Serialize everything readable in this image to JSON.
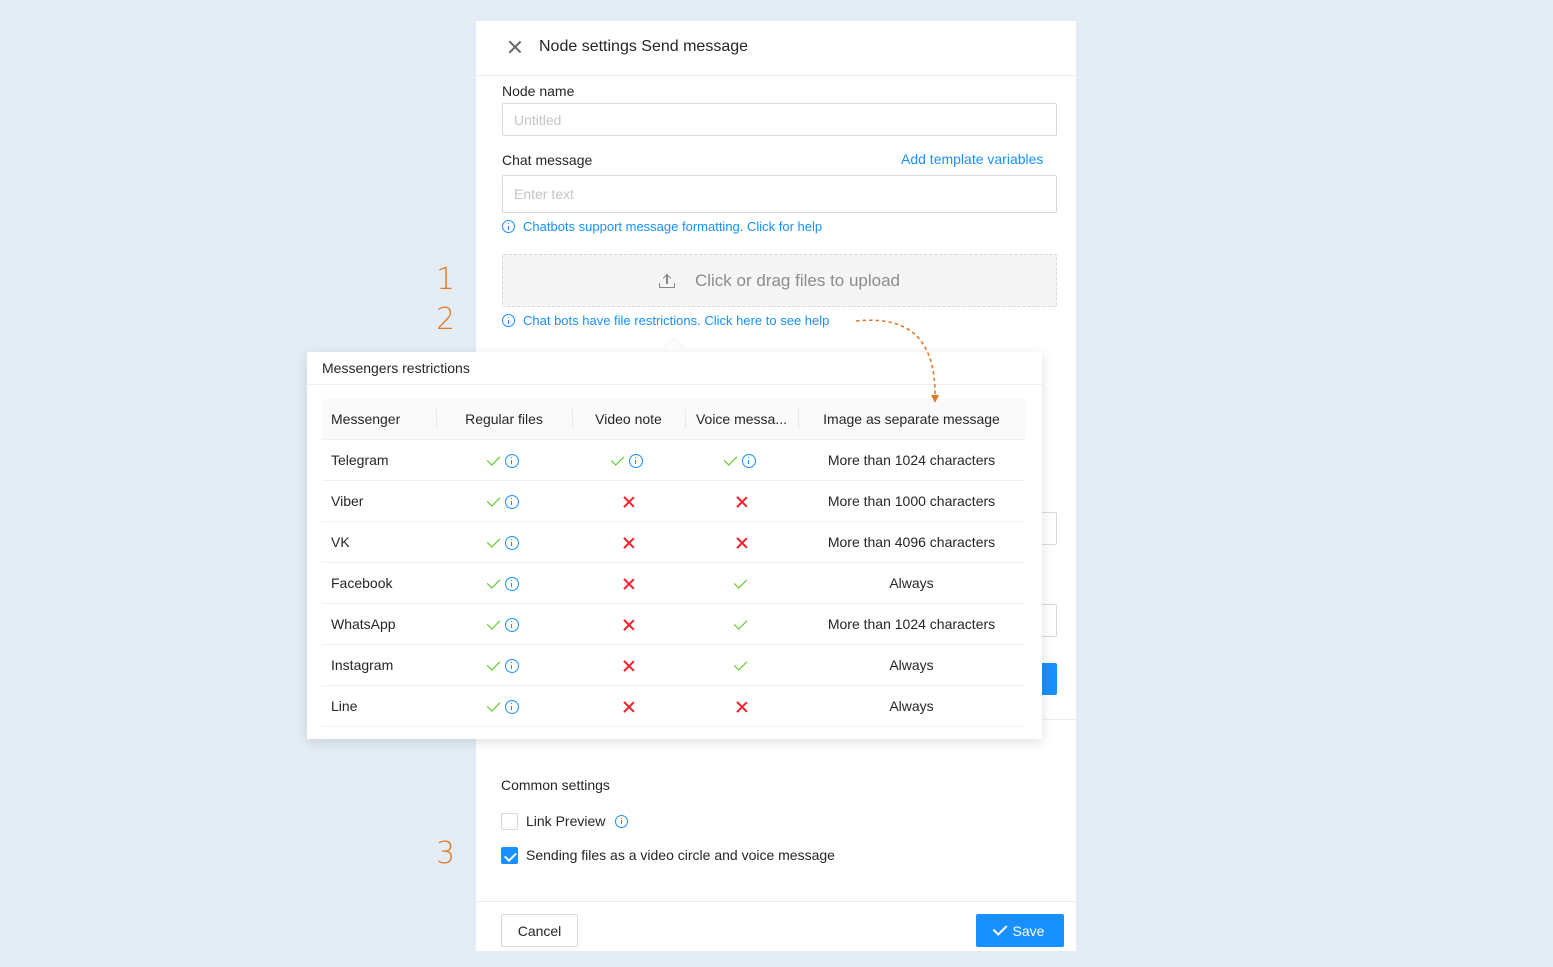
{
  "panel": {
    "title": "Node settings Send message",
    "node_name": {
      "label": "Node name",
      "placeholder": "Untitled",
      "value": ""
    },
    "chat_message": {
      "label": "Chat message",
      "placeholder": "Enter text",
      "value": "",
      "template_link": "Add template variables"
    },
    "formatting_hint": "Chatbots support message formatting. Click for help",
    "upload_text": "Click or drag files to upload",
    "restrictions_hint": "Chat bots have file restrictions. Click here to see help"
  },
  "popover": {
    "title": "Messengers restrictions",
    "columns": [
      "Messenger",
      "Regular files",
      "Video note",
      "Voice messa...",
      "Image as separate message"
    ],
    "rows": [
      {
        "messenger": "Telegram",
        "regular": "check",
        "video": "check",
        "voice": "check",
        "image": "More than 1024 characters"
      },
      {
        "messenger": "Viber",
        "regular": "check",
        "video": "cross",
        "voice": "cross",
        "image": "More than 1000 characters"
      },
      {
        "messenger": "VK",
        "regular": "check",
        "video": "cross",
        "voice": "cross",
        "image": "More than 4096 characters"
      },
      {
        "messenger": "Facebook",
        "regular": "check",
        "video": "cross",
        "voice": "check",
        "image": "Always"
      },
      {
        "messenger": "WhatsApp",
        "regular": "check",
        "video": "cross",
        "voice": "check",
        "image": "More than 1024 characters"
      },
      {
        "messenger": "Instagram",
        "regular": "check",
        "video": "cross",
        "voice": "check",
        "image": "Always"
      },
      {
        "messenger": "Line",
        "regular": "check",
        "video": "cross",
        "voice": "cross",
        "image": "Always"
      }
    ]
  },
  "common": {
    "title": "Common settings",
    "link_preview": {
      "label": "Link Preview",
      "checked": false
    },
    "send_files": {
      "label": "Sending files as a video circle and voice message",
      "checked": true
    }
  },
  "footer": {
    "cancel": "Cancel",
    "save": "Save"
  },
  "markers": [
    "1",
    "2",
    "3"
  ],
  "colors": {
    "accent": "#1890ff",
    "success": "#52c41a",
    "error": "#f5222d",
    "annotation": "#e07b2a",
    "background": "#e4ecf6"
  }
}
